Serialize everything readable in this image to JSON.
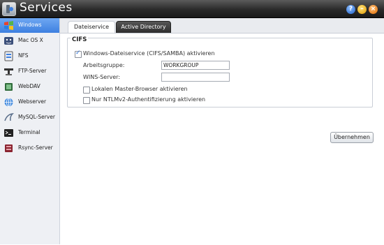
{
  "window": {
    "title": "Services",
    "help": "?"
  },
  "sidebar": {
    "items": [
      {
        "label": "Windows",
        "icon": "windows-icon",
        "active": true
      },
      {
        "label": "Mac OS X",
        "icon": "mac-icon"
      },
      {
        "label": "NFS",
        "icon": "nfs-icon"
      },
      {
        "label": "FTP-Server",
        "icon": "ftp-icon"
      },
      {
        "label": "WebDAV",
        "icon": "webdav-icon"
      },
      {
        "label": "Webserver",
        "icon": "webserver-icon"
      },
      {
        "label": "MySQL-Server",
        "icon": "mysql-icon"
      },
      {
        "label": "Terminal",
        "icon": "terminal-icon"
      },
      {
        "label": "Rsync-Server",
        "icon": "rsync-icon"
      }
    ]
  },
  "tabs": [
    {
      "label": "Dateiservice",
      "active": true
    },
    {
      "label": "Active Directory",
      "active": false
    }
  ],
  "cifs": {
    "legend": "CIFS",
    "enable_label": "Windows-Dateiservice (CIFS/SAMBA) aktivieren",
    "enable_checked": true,
    "workgroup_label": "Arbeitsgruppe:",
    "workgroup_value": "WORKGROUP",
    "wins_label": "WINS-Server:",
    "wins_value": "",
    "master_browser_label": "Lokalen Master-Browser aktivieren",
    "master_browser_checked": false,
    "ntlm_label": "Nur NTLMv2-Authentifizierung aktivieren",
    "ntlm_checked": false
  },
  "actions": {
    "apply_label": "Übernehmen"
  },
  "colors": {
    "accent": "#3d7fe0",
    "titlebar": "#2a2a2a",
    "tab_dark": "#2f2f2f"
  }
}
